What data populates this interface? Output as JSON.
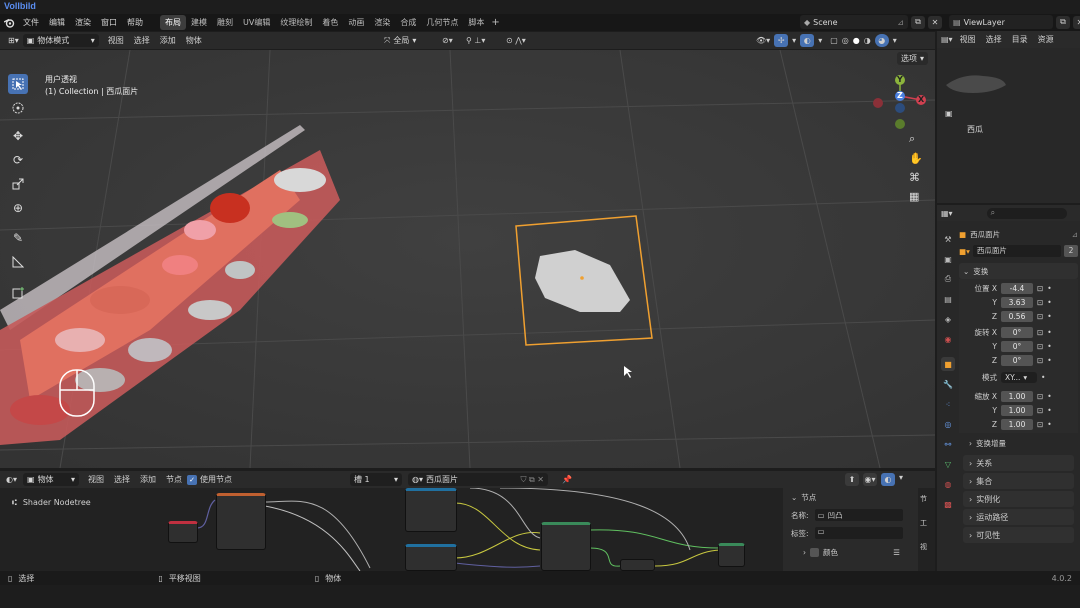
{
  "brand": "Vollbild",
  "menus": [
    "文件",
    "编辑",
    "渲染",
    "窗口",
    "帮助"
  ],
  "workspaces": [
    "布局",
    "建模",
    "雕刻",
    "UV编辑",
    "纹理绘制",
    "着色",
    "动画",
    "渲染",
    "合成",
    "几何节点",
    "脚本"
  ],
  "active_workspace": "布局",
  "scene": "Scene",
  "view_layer": "ViewLayer",
  "viewport": {
    "mode": "物体模式",
    "menu": [
      "视图",
      "选择",
      "添加",
      "物体"
    ],
    "orientation": "全局",
    "options": "选项",
    "overlay_title": "用户透视",
    "overlay_collection": "(1) Collection | 西瓜面片",
    "axes": {
      "x": "X",
      "y": "Y",
      "z": "Z"
    }
  },
  "outliner": {
    "menu": [
      "视图",
      "选择",
      "目录",
      "资源"
    ],
    "item": "西瓜"
  },
  "properties": {
    "object_name": "西瓜面片",
    "mesh_name": "西瓜面片",
    "users": "2",
    "transform_label": "变换",
    "location_label": "位置 X",
    "location": [
      "-4.4",
      "3.63",
      "0.56"
    ],
    "rotation_label": "旋转 X",
    "rotation": [
      "0°",
      "0°",
      "0°"
    ],
    "mode_label": "模式",
    "mode_value": "XY...",
    "scale_label": "缩放 X",
    "scale": [
      "1.00",
      "1.00",
      "1.00"
    ],
    "axis_y": "Y",
    "axis_z": "Z",
    "delta_label": "变换增量",
    "panels": [
      "关系",
      "集合",
      "实例化",
      "运动路径",
      "可见性"
    ]
  },
  "node_editor": {
    "type": "物体",
    "menu": [
      "视图",
      "选择",
      "添加",
      "节点"
    ],
    "use_nodes": "使用节点",
    "slot": "槽 1",
    "material": "西瓜面片",
    "tree": "Shader Nodetree",
    "side_header": "节点",
    "name_label": "名称:",
    "name_value": "凹凸",
    "label_label": "标签:",
    "color_label": "颜色"
  },
  "status": {
    "select": "选择",
    "pan": "平移视图",
    "object": "物体",
    "version": "4.0.2"
  },
  "colors": {
    "accent": "#4772b3",
    "selection": "#f0a030",
    "brand": "#5a8df0"
  }
}
